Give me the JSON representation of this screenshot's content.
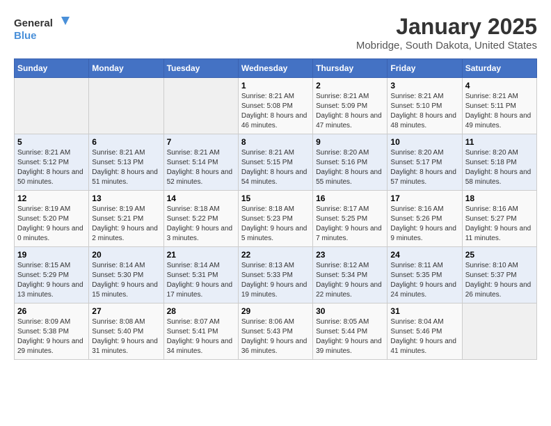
{
  "logo": {
    "line1": "General",
    "line2": "Blue"
  },
  "title": "January 2025",
  "subtitle": "Mobridge, South Dakota, United States",
  "days_of_week": [
    "Sunday",
    "Monday",
    "Tuesday",
    "Wednesday",
    "Thursday",
    "Friday",
    "Saturday"
  ],
  "weeks": [
    [
      {
        "day": "",
        "sunrise": "",
        "sunset": "",
        "daylight": ""
      },
      {
        "day": "",
        "sunrise": "",
        "sunset": "",
        "daylight": ""
      },
      {
        "day": "",
        "sunrise": "",
        "sunset": "",
        "daylight": ""
      },
      {
        "day": "1",
        "sunrise": "Sunrise: 8:21 AM",
        "sunset": "Sunset: 5:08 PM",
        "daylight": "Daylight: 8 hours and 46 minutes."
      },
      {
        "day": "2",
        "sunrise": "Sunrise: 8:21 AM",
        "sunset": "Sunset: 5:09 PM",
        "daylight": "Daylight: 8 hours and 47 minutes."
      },
      {
        "day": "3",
        "sunrise": "Sunrise: 8:21 AM",
        "sunset": "Sunset: 5:10 PM",
        "daylight": "Daylight: 8 hours and 48 minutes."
      },
      {
        "day": "4",
        "sunrise": "Sunrise: 8:21 AM",
        "sunset": "Sunset: 5:11 PM",
        "daylight": "Daylight: 8 hours and 49 minutes."
      }
    ],
    [
      {
        "day": "5",
        "sunrise": "Sunrise: 8:21 AM",
        "sunset": "Sunset: 5:12 PM",
        "daylight": "Daylight: 8 hours and 50 minutes."
      },
      {
        "day": "6",
        "sunrise": "Sunrise: 8:21 AM",
        "sunset": "Sunset: 5:13 PM",
        "daylight": "Daylight: 8 hours and 51 minutes."
      },
      {
        "day": "7",
        "sunrise": "Sunrise: 8:21 AM",
        "sunset": "Sunset: 5:14 PM",
        "daylight": "Daylight: 8 hours and 52 minutes."
      },
      {
        "day": "8",
        "sunrise": "Sunrise: 8:21 AM",
        "sunset": "Sunset: 5:15 PM",
        "daylight": "Daylight: 8 hours and 54 minutes."
      },
      {
        "day": "9",
        "sunrise": "Sunrise: 8:20 AM",
        "sunset": "Sunset: 5:16 PM",
        "daylight": "Daylight: 8 hours and 55 minutes."
      },
      {
        "day": "10",
        "sunrise": "Sunrise: 8:20 AM",
        "sunset": "Sunset: 5:17 PM",
        "daylight": "Daylight: 8 hours and 57 minutes."
      },
      {
        "day": "11",
        "sunrise": "Sunrise: 8:20 AM",
        "sunset": "Sunset: 5:18 PM",
        "daylight": "Daylight: 8 hours and 58 minutes."
      }
    ],
    [
      {
        "day": "12",
        "sunrise": "Sunrise: 8:19 AM",
        "sunset": "Sunset: 5:20 PM",
        "daylight": "Daylight: 9 hours and 0 minutes."
      },
      {
        "day": "13",
        "sunrise": "Sunrise: 8:19 AM",
        "sunset": "Sunset: 5:21 PM",
        "daylight": "Daylight: 9 hours and 2 minutes."
      },
      {
        "day": "14",
        "sunrise": "Sunrise: 8:18 AM",
        "sunset": "Sunset: 5:22 PM",
        "daylight": "Daylight: 9 hours and 3 minutes."
      },
      {
        "day": "15",
        "sunrise": "Sunrise: 8:18 AM",
        "sunset": "Sunset: 5:23 PM",
        "daylight": "Daylight: 9 hours and 5 minutes."
      },
      {
        "day": "16",
        "sunrise": "Sunrise: 8:17 AM",
        "sunset": "Sunset: 5:25 PM",
        "daylight": "Daylight: 9 hours and 7 minutes."
      },
      {
        "day": "17",
        "sunrise": "Sunrise: 8:16 AM",
        "sunset": "Sunset: 5:26 PM",
        "daylight": "Daylight: 9 hours and 9 minutes."
      },
      {
        "day": "18",
        "sunrise": "Sunrise: 8:16 AM",
        "sunset": "Sunset: 5:27 PM",
        "daylight": "Daylight: 9 hours and 11 minutes."
      }
    ],
    [
      {
        "day": "19",
        "sunrise": "Sunrise: 8:15 AM",
        "sunset": "Sunset: 5:29 PM",
        "daylight": "Daylight: 9 hours and 13 minutes."
      },
      {
        "day": "20",
        "sunrise": "Sunrise: 8:14 AM",
        "sunset": "Sunset: 5:30 PM",
        "daylight": "Daylight: 9 hours and 15 minutes."
      },
      {
        "day": "21",
        "sunrise": "Sunrise: 8:14 AM",
        "sunset": "Sunset: 5:31 PM",
        "daylight": "Daylight: 9 hours and 17 minutes."
      },
      {
        "day": "22",
        "sunrise": "Sunrise: 8:13 AM",
        "sunset": "Sunset: 5:33 PM",
        "daylight": "Daylight: 9 hours and 19 minutes."
      },
      {
        "day": "23",
        "sunrise": "Sunrise: 8:12 AM",
        "sunset": "Sunset: 5:34 PM",
        "daylight": "Daylight: 9 hours and 22 minutes."
      },
      {
        "day": "24",
        "sunrise": "Sunrise: 8:11 AM",
        "sunset": "Sunset: 5:35 PM",
        "daylight": "Daylight: 9 hours and 24 minutes."
      },
      {
        "day": "25",
        "sunrise": "Sunrise: 8:10 AM",
        "sunset": "Sunset: 5:37 PM",
        "daylight": "Daylight: 9 hours and 26 minutes."
      }
    ],
    [
      {
        "day": "26",
        "sunrise": "Sunrise: 8:09 AM",
        "sunset": "Sunset: 5:38 PM",
        "daylight": "Daylight: 9 hours and 29 minutes."
      },
      {
        "day": "27",
        "sunrise": "Sunrise: 8:08 AM",
        "sunset": "Sunset: 5:40 PM",
        "daylight": "Daylight: 9 hours and 31 minutes."
      },
      {
        "day": "28",
        "sunrise": "Sunrise: 8:07 AM",
        "sunset": "Sunset: 5:41 PM",
        "daylight": "Daylight: 9 hours and 34 minutes."
      },
      {
        "day": "29",
        "sunrise": "Sunrise: 8:06 AM",
        "sunset": "Sunset: 5:43 PM",
        "daylight": "Daylight: 9 hours and 36 minutes."
      },
      {
        "day": "30",
        "sunrise": "Sunrise: 8:05 AM",
        "sunset": "Sunset: 5:44 PM",
        "daylight": "Daylight: 9 hours and 39 minutes."
      },
      {
        "day": "31",
        "sunrise": "Sunrise: 8:04 AM",
        "sunset": "Sunset: 5:46 PM",
        "daylight": "Daylight: 9 hours and 41 minutes."
      },
      {
        "day": "",
        "sunrise": "",
        "sunset": "",
        "daylight": ""
      }
    ]
  ]
}
